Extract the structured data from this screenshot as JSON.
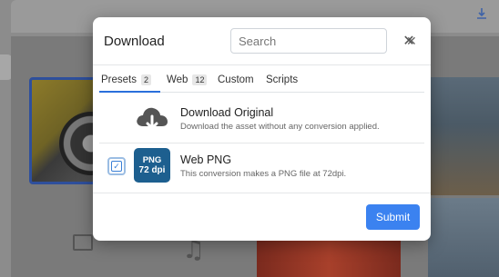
{
  "dialog": {
    "title": "Download",
    "search_placeholder": "Search",
    "clear_glyph": "✕",
    "close_glyph": "✕"
  },
  "tabs": [
    {
      "label": "Presets",
      "badge": "2"
    },
    {
      "label": "Web",
      "badge": "12"
    },
    {
      "label": "Custom"
    },
    {
      "label": "Scripts"
    }
  ],
  "options": [
    {
      "title": "Download Original",
      "description": "Download the asset without any conversion applied.",
      "icon": "cloud-download-icon"
    },
    {
      "title": "Web PNG",
      "description": "This conversion makes a PNG file at 72dpi.",
      "icon_line1": "PNG",
      "icon_line2": "72 dpi",
      "checked": true
    }
  ],
  "footer": {
    "submit_label": "Submit"
  },
  "colors": {
    "accent": "#3b82f0",
    "png_badge": "#1d5f8f"
  }
}
